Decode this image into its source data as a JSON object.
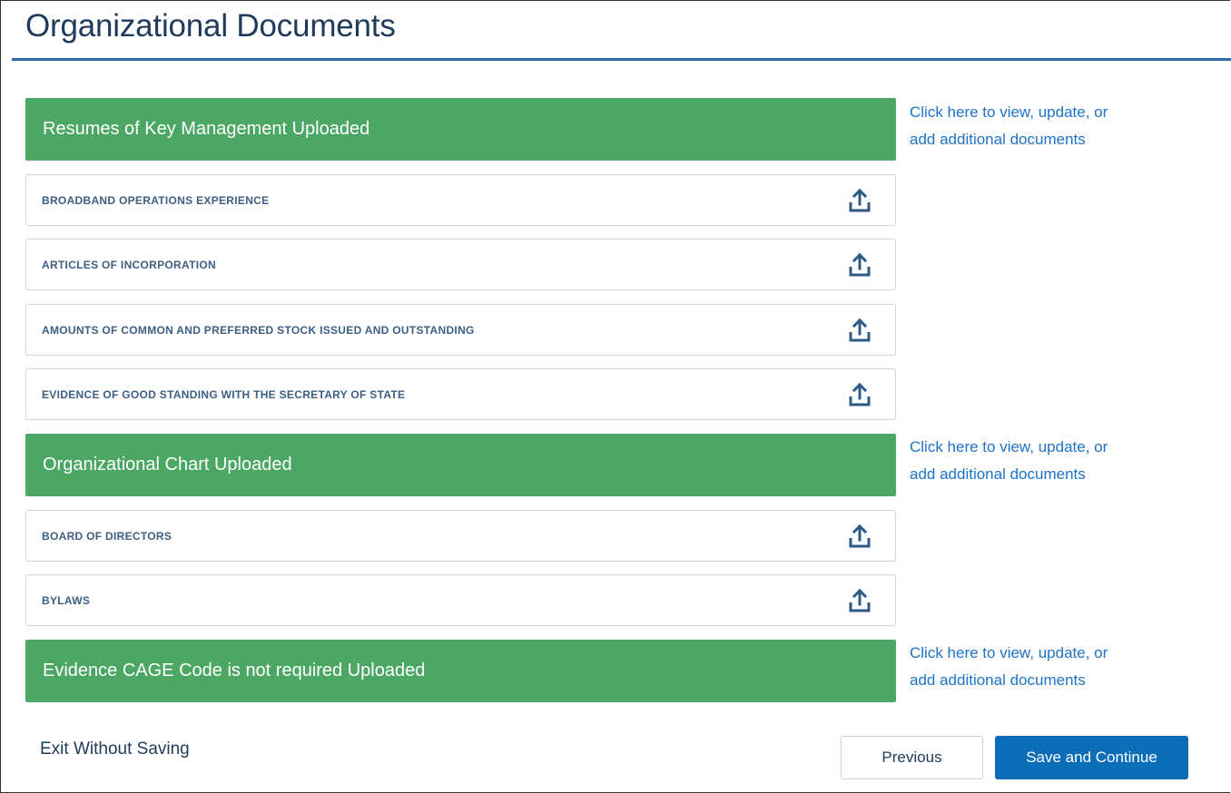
{
  "page": {
    "title": "Organizational Documents"
  },
  "sections": [
    {
      "label": "Resumes of Key Management Uploaded",
      "link_line1": "Click here to view, update, or",
      "link_line2": "add additional documents"
    },
    {
      "label": "Organizational Chart Uploaded",
      "link_line1": "Click here to view, update, or",
      "link_line2": "add additional documents"
    },
    {
      "label": "Evidence CAGE Code is not required Uploaded",
      "link_line1": "Click here to view, update, or",
      "link_line2": "add additional documents"
    }
  ],
  "documents": [
    {
      "label": "BROADBAND OPERATIONS EXPERIENCE",
      "icon": "upload-icon"
    },
    {
      "label": "ARTICLES OF INCORPORATION",
      "icon": "upload-icon"
    },
    {
      "label": "AMOUNTS OF COMMON AND PREFERRED STOCK ISSUED AND OUTSTANDING",
      "icon": "upload-icon"
    },
    {
      "label": "EVIDENCE OF GOOD STANDING WITH THE SECRETARY OF STATE",
      "icon": "upload-icon"
    },
    {
      "label": "BOARD OF DIRECTORS",
      "icon": "upload-icon"
    },
    {
      "label": "BYLAWS",
      "icon": "upload-icon"
    }
  ],
  "footer": {
    "exit_label": "Exit Without Saving",
    "previous_label": "Previous",
    "save_label": "Save and Continue"
  },
  "colors": {
    "section_green": "#4ca764",
    "link_blue": "#1e73c8",
    "primary_button": "#0b6cb8",
    "title_navy": "#1f3a5a",
    "rule_blue": "#2f6cb0"
  }
}
